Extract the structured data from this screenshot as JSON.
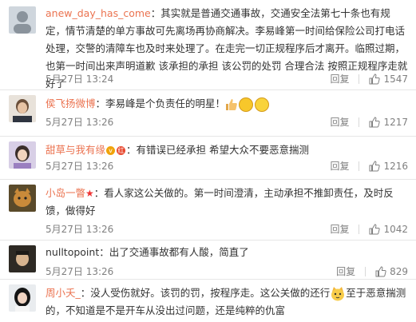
{
  "comments": [
    {
      "user": "anew_day_has_come",
      "text": "：其实就是普通交通事故，交通安全法第七十条也有规定，情节清楚的单方事故可先离场再协商解决。李易峰第一时间给保险公司打电话处理，交警的清障车也及时来处理了。在走完一切正规程序后才离开。临照过期，也第一时间出来声明道歉 该承担的承担 该公罚的处罚 合理合法 按照正规程序走就好了",
      "time": "5月27日 13:24",
      "reply": "回复",
      "likes": "1547"
    },
    {
      "user": "侯飞扬微博",
      "text": "：李易峰是个负责任的明星！",
      "time": "5月27日 13:26",
      "reply": "回复",
      "likes": "1217"
    },
    {
      "user": "甜草与我有缘",
      "badge": "红",
      "text": "：有错误已经承担  希望大众不要恶意揣测",
      "time": "5月27日 13:26",
      "reply": "回复",
      "likes": "1216"
    },
    {
      "user": "小岛一瞥",
      "star": "★",
      "text": "：看人家这公关做的。第一时间澄清，主动承担不推卸责任，及时反馈，做得好",
      "time": "5月27日 13:26",
      "reply": "回复",
      "likes": "1042"
    },
    {
      "user": "nulltopoint",
      "text": "：出了交通事故都有人酸，简直了",
      "time": "5月27日 13:26",
      "reply": "回复",
      "likes": "829"
    },
    {
      "user": "周小夭_",
      "text_a": "：没人受伤就好。该罚的罚，按程序走。这公关做的还行",
      "text_b": "至于恶意揣测的，不知道是不是开车从没出过问题，还是纯粹的仇富"
    }
  ],
  "icons": {
    "like": "thumbs-up-icon",
    "vip": "vip-badge-icon"
  },
  "colors": {
    "username": "#eb7350",
    "meta": "#808080"
  }
}
